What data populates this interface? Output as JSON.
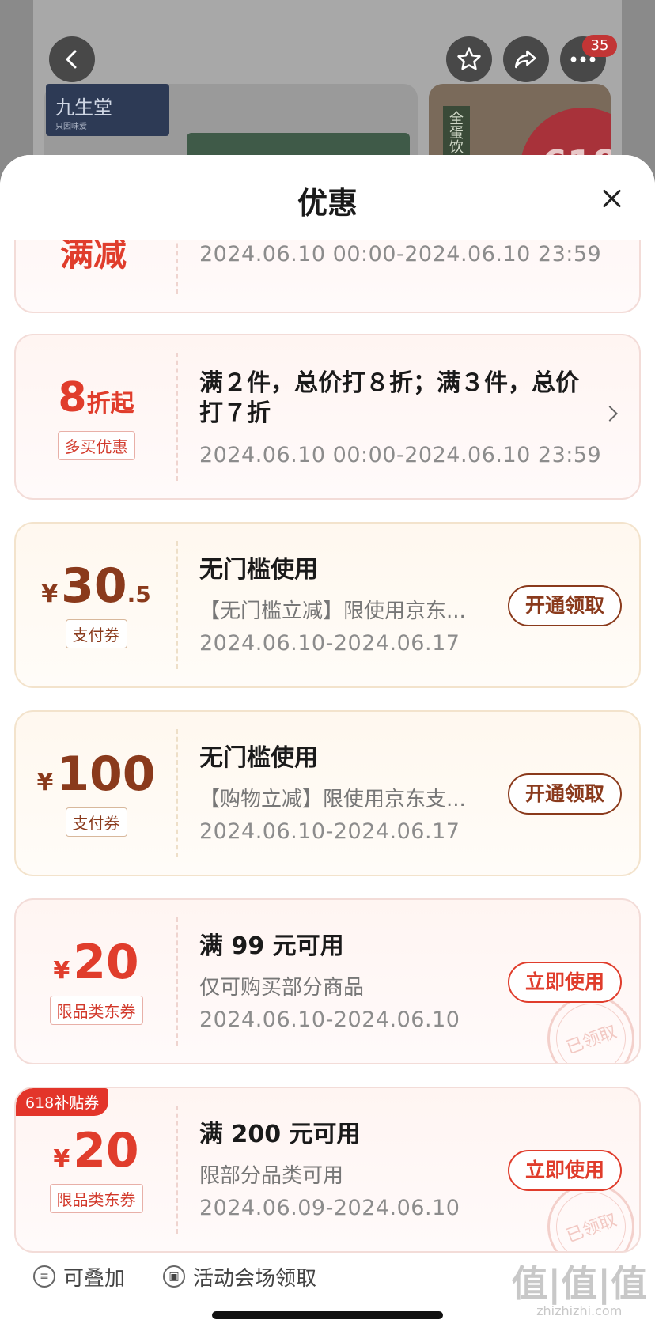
{
  "background": {
    "brand_logo": "九生堂",
    "brand_logo_sub": "只因味爱",
    "side_tag": "全蛋饮",
    "promo_618": "618",
    "cart_badge": "35"
  },
  "sheet": {
    "title": "优惠"
  },
  "coupons": [
    {
      "left_big": "满减",
      "date": "2024.06.10 00:00-2024.06.10 23:59"
    },
    {
      "discount_number": "8",
      "discount_unit": "折起",
      "tag": "多买优惠",
      "title_line1": "满２件，总价打８折；满３件，总价",
      "title_line2": "打７折",
      "date": "2024.06.10 00:00-2024.06.10 23:59"
    },
    {
      "currency": "¥",
      "amount": "30",
      "decimal": ".5",
      "tag": "支付券",
      "title": "无门槛使用",
      "subtitle": "【无门槛立减】限使用京东...",
      "date": "2024.06.10-2024.06.17",
      "button": "开通领取"
    },
    {
      "currency": "¥",
      "amount": "100",
      "tag": "支付券",
      "title": "无门槛使用",
      "subtitle": "【购物立减】限使用京东支...",
      "date": "2024.06.10-2024.06.17",
      "button": "开通领取"
    },
    {
      "currency": "¥",
      "amount": "20",
      "tag": "限品类东券",
      "title": "满 99 元可用",
      "subtitle": "仅可购买部分商品",
      "date": "2024.06.10-2024.06.10",
      "button": "立即使用",
      "stamp": "已领取"
    },
    {
      "corner_tag": "618补贴券",
      "currency": "¥",
      "amount": "20",
      "tag": "限品类东券",
      "title": "满 200 元可用",
      "subtitle": "限部分品类可用",
      "date": "2024.06.09-2024.06.10",
      "button": "立即使用",
      "stamp": "已领取"
    }
  ],
  "bottom_bar": {
    "stackable_label": "可叠加",
    "venue_label": "活动会场领取"
  },
  "watermark": {
    "main": "值|值|值",
    "url": "zhizhizhi.com"
  },
  "colors": {
    "accent_red": "#e03d2c",
    "pay_brown": "#8a3a1c"
  }
}
